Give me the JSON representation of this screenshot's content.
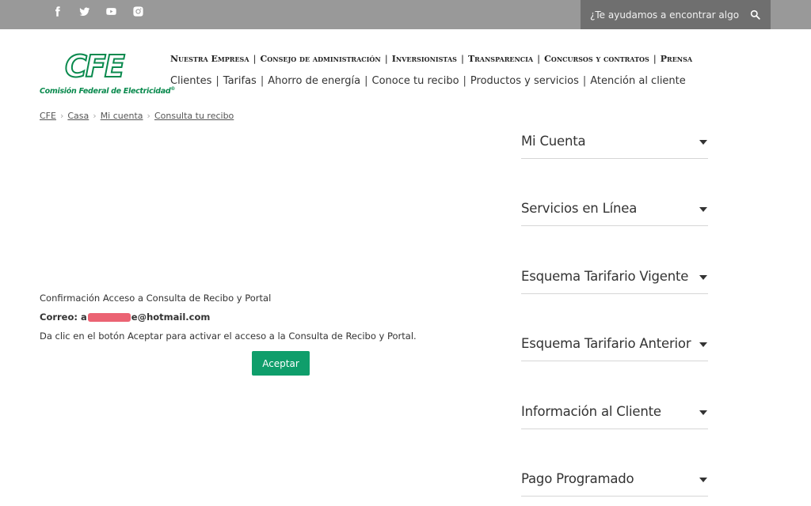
{
  "topbar": {
    "social": [
      "facebook-icon",
      "twitter-icon",
      "youtube-icon",
      "instagram-icon"
    ],
    "search_placeholder": "¿Te ayudamos a encontrar algo?"
  },
  "logo": {
    "mark": "CFE",
    "subtitle": "Comisión Federal de Electricidad"
  },
  "nav_primary": [
    "Nuestra Empresa",
    "Consejo de administración",
    "Inversionistas",
    "Transparencia",
    "Concursos y contratos",
    "Prensa"
  ],
  "nav_secondary": [
    "Clientes",
    "Tarifas",
    "Ahorro de energía",
    "Conoce tu recibo",
    "Productos y servicios",
    "Atención al cliente"
  ],
  "breadcrumb": [
    "CFE",
    "Casa",
    "Mi cuenta",
    "Consulta tu recibo"
  ],
  "main": {
    "title": "Confirmación Acceso a Consulta de Recibo y Portal",
    "email_label": "Correo:",
    "email_visible_start": "a",
    "email_visible_end": "e@hotmail.com",
    "instructions": "Da clic en el botón Aceptar para activar el acceso a la Consulta de Recibo y Portal.",
    "accept_label": "Aceptar"
  },
  "sidebar": {
    "items": [
      {
        "label": "Mi Cuenta"
      },
      {
        "label": "Servicios en Línea"
      },
      {
        "label": "Esquema Tarifario Vigente"
      },
      {
        "label": "Esquema Tarifario Anterior"
      },
      {
        "label": "Información al Cliente"
      },
      {
        "label": "Pago Programado"
      }
    ]
  },
  "colors": {
    "topbar": "#999999",
    "search_bg": "#6f6f6f",
    "brand_green": "#0a8a4e",
    "button_green": "#0f9e6b"
  }
}
